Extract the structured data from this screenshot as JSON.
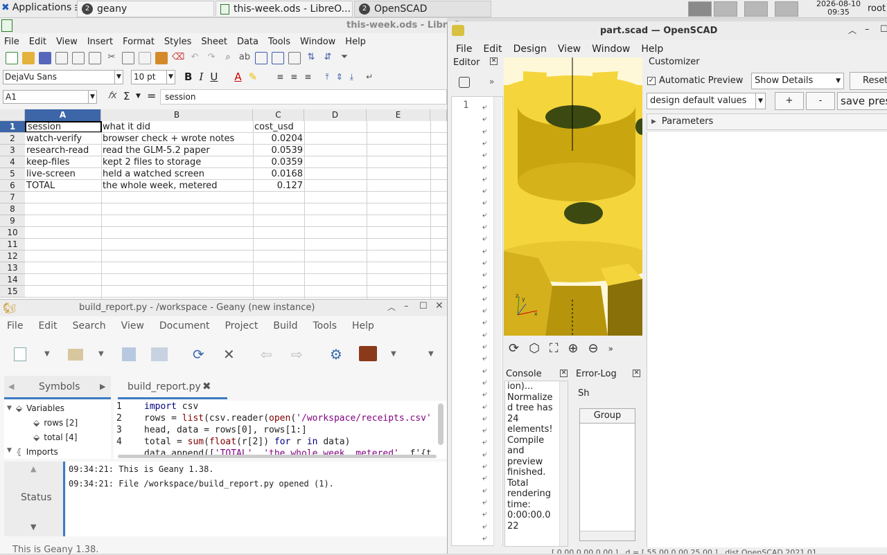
{
  "taskbar": {
    "apps_label": "Applications",
    "tasks": [
      {
        "label": "geany",
        "badge": "2"
      },
      {
        "label": "this-week.ods - LibreO..."
      },
      {
        "label": "OpenSCAD",
        "badge": "2"
      }
    ],
    "clock_date": "2026-08-10",
    "clock_time": "09:35",
    "user": "root"
  },
  "calc": {
    "title": "this-week.ods - LibreO",
    "menu": [
      "File",
      "Edit",
      "View",
      "Insert",
      "Format",
      "Styles",
      "Sheet",
      "Data",
      "Tools",
      "Window",
      "Help"
    ],
    "font_name": "DejaVu Sans",
    "font_size": "10 pt",
    "name_box": "A1",
    "formula": "session",
    "columns": [
      "A",
      "B",
      "C",
      "D",
      "E"
    ],
    "rows": [
      "1",
      "2",
      "3",
      "4",
      "5",
      "6",
      "7",
      "8",
      "9",
      "10",
      "11",
      "12",
      "13",
      "14",
      "15"
    ],
    "cells": [
      [
        "session",
        "what it did",
        "cost_usd"
      ],
      [
        "watch-verify",
        "browser check + wrote notes",
        "0.0204"
      ],
      [
        "research-read",
        "read the GLM-5.2 paper",
        "0.0539"
      ],
      [
        "keep-files",
        "kept 2 files to storage",
        "0.0359"
      ],
      [
        "live-screen",
        "held a watched screen",
        "0.0168"
      ],
      [
        "TOTAL",
        "the whole week, metered",
        "0.127"
      ]
    ]
  },
  "geany": {
    "title": "build_report.py - /workspace - Geany (new instance)",
    "menu": [
      "File",
      "Edit",
      "Search",
      "View",
      "Document",
      "Project",
      "Build",
      "Tools",
      "Help"
    ],
    "sidebar_tab": "Symbols",
    "doc_tab": "build_report.py",
    "symbols": {
      "variables": "Variables",
      "rows": "rows [2]",
      "total": "total [4]",
      "imports": "Imports"
    },
    "line_numbers": [
      "1",
      "2",
      "3",
      "4"
    ],
    "code": {
      "l1_kw": "import",
      "l1_rest": " csv",
      "l2_a": "rows = ",
      "l2_fn1": "list",
      "l2_b": "(csv.reader(",
      "l2_fn2": "open",
      "l2_c": "(",
      "l2_str": "'/workspace/receipts.csv'",
      "l3": "head, data = rows[0], rows[1:]",
      "l4_a": "total = ",
      "l4_fn1": "sum",
      "l4_b": "(",
      "l4_fn2": "float",
      "l4_c": "(r[2]) ",
      "l4_kw1": "for",
      "l4_d": " r ",
      "l4_kw2": "in",
      "l4_e": " data)",
      "l5_a": "data.append([",
      "l5_s1": "'TOTAL'",
      "l5_b": ", ",
      "l5_s2": "'the whole week, metered'",
      "l5_c": ", f'{t"
    },
    "messages": [
      "09:34:21: This is Geany 1.38.",
      "09:34:21: File /workspace/build_report.py opened (1)."
    ],
    "msg_tab": "Status",
    "statusbar": "This is Geany 1.38."
  },
  "scad": {
    "title": "part.scad — OpenSCAD",
    "menu": [
      "File",
      "Edit",
      "Design",
      "View",
      "Window",
      "Help"
    ],
    "editor_label": "Editor",
    "editor_line": "1",
    "customizer_label": "Customizer",
    "auto_preview": "Automatic Preview",
    "show_details": "Show Details",
    "reset": "Reset",
    "preset": "design default values",
    "plus": "+",
    "minus": "-",
    "save_preset": "save pres",
    "parameters": "Parameters",
    "console_label": "Console",
    "console_text": "ion)...\nNormalize\nd tree has\n24\nelements!\nCompile\nand\npreview\nfinished.\nTotal\nrendering\ntime:\n0:00:00.0\n22",
    "errorlog_label": "Error-Log",
    "group_label": "Group",
    "sh_label": "Sh",
    "status_text": "[ 0.00 0.00 0.00 ] , d = [ 55.00 0.00 25.00 ] , dist   OpenSCAD 2021.01",
    "colors": {
      "model": "#f5d53c",
      "model_dark": "#c9a50f",
      "hole": "#3c4a12"
    }
  }
}
